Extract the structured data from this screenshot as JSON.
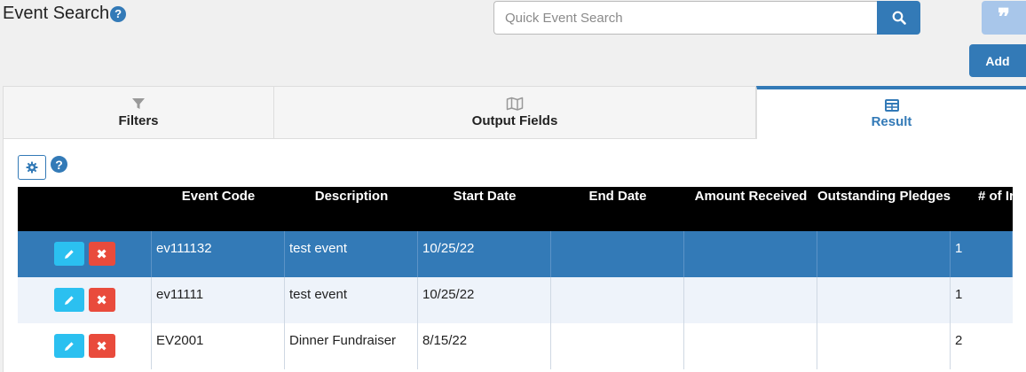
{
  "header": {
    "title": "Event Search",
    "help_glyph": "?"
  },
  "search": {
    "placeholder": "Quick Event Search",
    "value": ""
  },
  "toolbar": {
    "quote_glyph": "❞",
    "add_label": "Add"
  },
  "tabs": [
    {
      "label": "Filters",
      "icon": "filter-icon"
    },
    {
      "label": "Output Fields",
      "icon": "map-icon"
    },
    {
      "label": "Result",
      "icon": "table-icon",
      "active": true
    }
  ],
  "grid": {
    "help_glyph": "?",
    "columns": [
      "",
      "Event Code",
      "Description",
      "Start Date",
      "End Date",
      "Amount Received",
      "Outstanding Pledges",
      "# of Ir"
    ],
    "rows": [
      {
        "code": "ev111132",
        "description": "test event",
        "start": "10/25/22",
        "end": "",
        "amount": "",
        "outstanding": "",
        "num": "1",
        "selected": true
      },
      {
        "code": "ev11111",
        "description": "test event",
        "start": "10/25/22",
        "end": "",
        "amount": "",
        "outstanding": "",
        "num": "1"
      },
      {
        "code": "EV2001",
        "description": "Dinner Fundraiser",
        "start": "8/15/22",
        "end": "",
        "amount": "",
        "outstanding": "",
        "num": "2"
      }
    ],
    "delete_glyph": "✖"
  },
  "colors": {
    "accent": "#337ab7",
    "edit": "#2bc0f0",
    "delete": "#e94b3c",
    "quote_button": "#a8c6ea",
    "header_bg": "#000000"
  }
}
